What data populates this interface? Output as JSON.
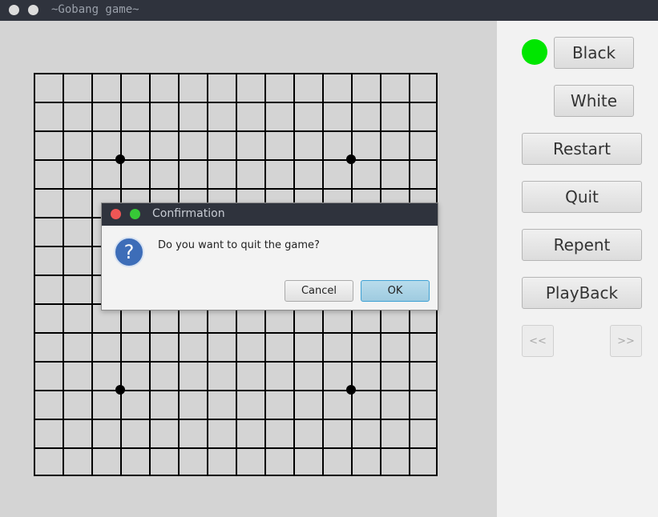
{
  "window": {
    "title": "~Gobang game~"
  },
  "side": {
    "turn_color": "#00e600",
    "black_label": "Black",
    "white_label": "White",
    "restart_label": "Restart",
    "quit_label": "Quit",
    "repent_label": "Repent",
    "playback_label": "PlayBack",
    "prev_label": "<<",
    "next_label": ">>"
  },
  "board": {
    "lines": 15,
    "star_points": [
      "D4",
      "L4",
      "D12",
      "L12"
    ]
  },
  "dialog": {
    "title": "Confirmation",
    "message": "Do you want to quit the game?",
    "icon": "question-icon",
    "cancel_label": "Cancel",
    "ok_label": "OK"
  }
}
